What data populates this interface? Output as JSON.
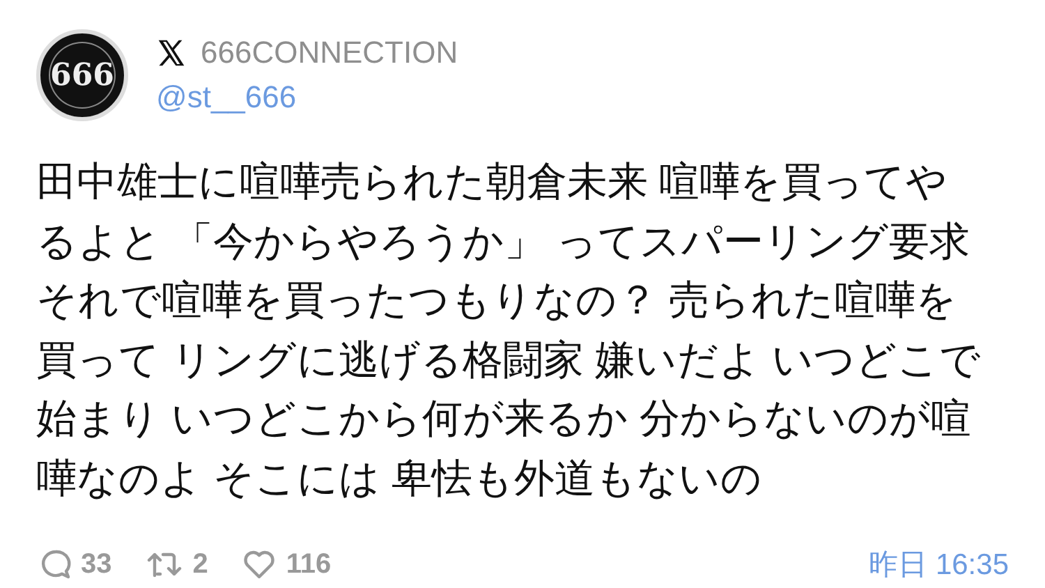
{
  "author": {
    "avatar_text": "666",
    "name": "666CONNECTION",
    "handle": "@st__666"
  },
  "text_lines": [
    "田中雄士に喧嘩売られた朝倉未来 喧嘩を買ってや",
    "るよと 「今からやろうか」 ってスパーリング要求",
    "それで喧嘩を買ったつもりなの？ 売られた喧嘩を",
    "買って リングに逃げる格闘家 嫌いだよ いつどこで",
    "始まり いつどこから何が来るか 分からないのが喧",
    "嘩なのよ そこには 卑怯も外道もないの"
  ],
  "stats": [
    {
      "kind": "reply",
      "count": "33"
    },
    {
      "kind": "repost",
      "count": "2"
    },
    {
      "kind": "like",
      "count": "116"
    }
  ],
  "time": "昨日 16:35"
}
